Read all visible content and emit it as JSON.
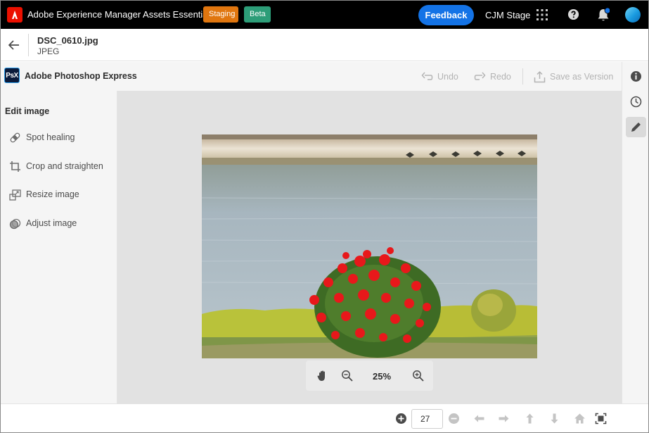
{
  "header": {
    "app_title": "Adobe Experience Manager Assets Essentials",
    "badges": [
      "Staging",
      "Beta"
    ],
    "feedback_label": "Feedback",
    "org_name": "CJM Stage",
    "icons": [
      "adobe-logo",
      "apps-grid-icon",
      "help-icon",
      "bell-icon",
      "avatar"
    ]
  },
  "asset": {
    "file_name": "DSC_0610.jpg",
    "file_type": "JPEG"
  },
  "editor": {
    "app_name": "Adobe Photoshop Express",
    "app_logo_text": "PsX",
    "undo_label": "Undo",
    "redo_label": "Redo",
    "save_version_label": "Save as Version"
  },
  "edit_panel": {
    "heading": "Edit image",
    "tools": [
      {
        "label": "Spot healing",
        "icon": "bandage-icon"
      },
      {
        "label": "Crop and straighten",
        "icon": "crop-icon"
      },
      {
        "label": "Resize image",
        "icon": "resize-icon"
      },
      {
        "label": "Adjust image",
        "icon": "adjust-icon"
      }
    ]
  },
  "canvas": {
    "zoom_level": "25%"
  },
  "pagination": {
    "page_value": "27"
  },
  "colors": {
    "accent": "#1473e6",
    "staging": "#e0760f",
    "beta": "#2d9d78",
    "adobe_red": "#eb1000"
  }
}
